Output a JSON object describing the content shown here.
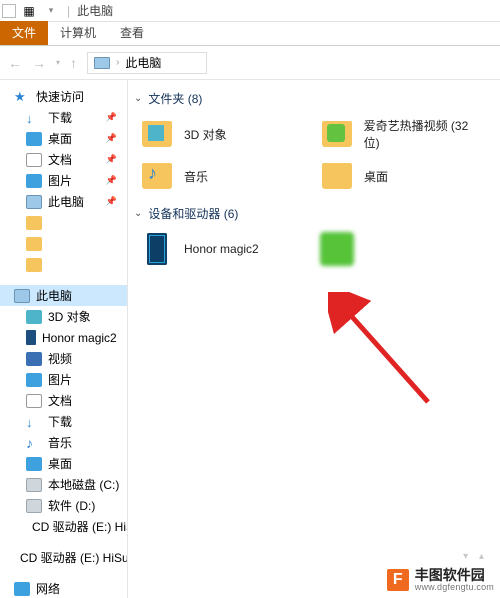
{
  "titlebar": {
    "title": "此电脑"
  },
  "ribbon": {
    "file": "文件",
    "computer": "计算机",
    "view": "查看"
  },
  "addressbar": {
    "location": "此电脑"
  },
  "sidebar": {
    "quick_access": "快速访问",
    "downloads": "下载",
    "desktop": "桌面",
    "documents": "文档",
    "pictures": "图片",
    "this_pc": "此电脑",
    "redacted1": " ",
    "redacted2": " ",
    "redacted3": " ",
    "tp_3d": "3D 对象",
    "tp_phone": "Honor magic2",
    "tp_video": "视频",
    "tp_pictures": "图片",
    "tp_documents": "文档",
    "tp_downloads": "下载",
    "tp_music": "音乐",
    "tp_desktop": "桌面",
    "tp_c": "本地磁盘 (C:)",
    "tp_d": "软件 (D:)",
    "tp_e": "CD 驱动器 (E:) HiS",
    "cd_e": "CD 驱动器 (E:) HiSui",
    "network": "网络"
  },
  "content": {
    "group_folders": "文件夹 (8)",
    "group_devices": "设备和驱动器 (6)",
    "folders": {
      "obj3d": "3D 对象",
      "iqiyi": "爱奇艺热播视频 (32 位)",
      "music": "音乐",
      "desktop": "桌面"
    },
    "devices": {
      "phone": "Honor magic2",
      "blurred": " "
    }
  },
  "watermark": {
    "logo": "F",
    "line1": "丰图软件园",
    "line2": "www.dgfengtu.com"
  }
}
